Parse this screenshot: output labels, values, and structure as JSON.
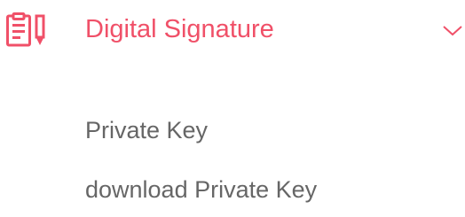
{
  "menu": {
    "header": {
      "icon": "clipboard-pencil-icon",
      "label": "Digital Signature",
      "expanded": true,
      "accent_color": "#f05068",
      "chevron_icon": "chevron-down-icon"
    },
    "items": [
      {
        "label": "Private Key"
      },
      {
        "label": "download Private Key"
      }
    ],
    "item_color": "#666666"
  }
}
